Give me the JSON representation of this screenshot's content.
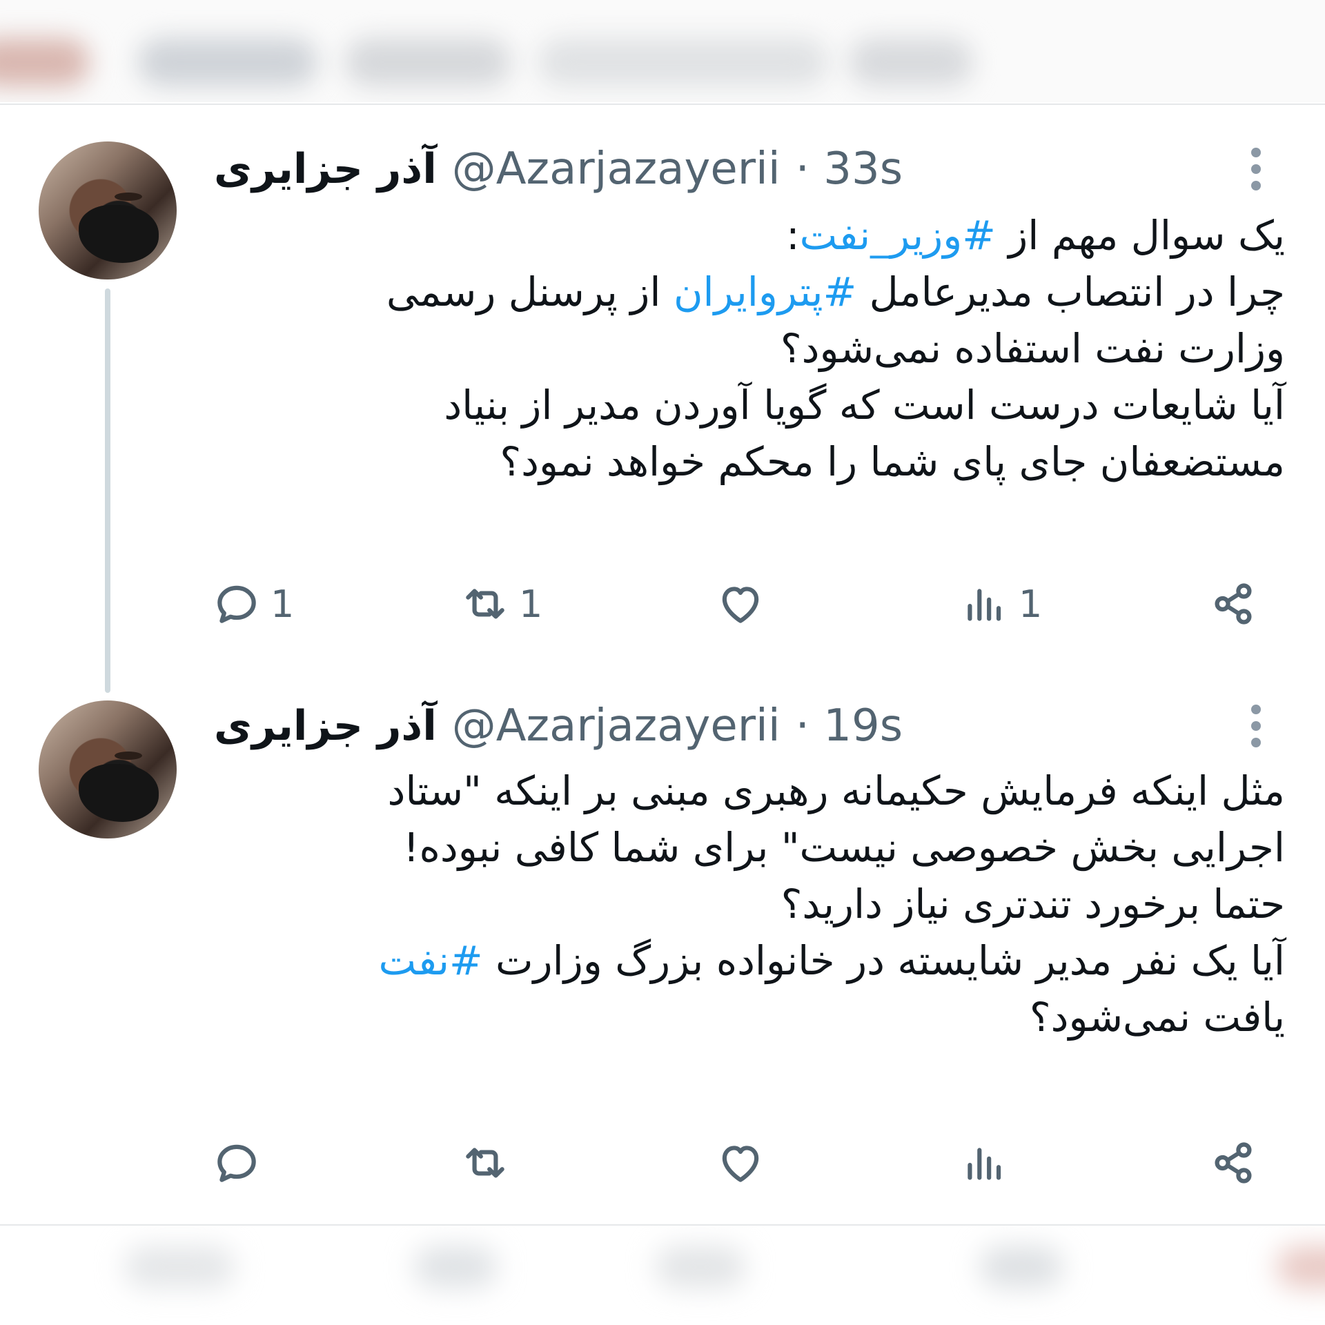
{
  "tweets": [
    {
      "name": "آذر جزایری",
      "handle": "@Azarjazayerii",
      "time": "· 33s",
      "lines": [
        [
          {
            "t": "یک سوال مهم از "
          },
          {
            "t": "#وزیر_نفت",
            "tag": true
          },
          {
            "t": ":"
          }
        ],
        [
          {
            "t": "چرا در انتصاب مدیرعامل "
          },
          {
            "t": "#پتروایران",
            "tag": true
          },
          {
            "t": " از پرسنل رسمی"
          }
        ],
        [
          {
            "t": "وزارت نفت استفاده نمی‌شود؟"
          }
        ],
        [
          {
            "t": "آیا شایعات درست است که گویا آوردن مدیر از بنیاد"
          }
        ],
        [
          {
            "t": "مستضعفان جای پای شما را محکم خواهد نمود؟"
          }
        ]
      ],
      "actions": {
        "reply": "1",
        "retweet": "1",
        "like": "",
        "views": "1"
      }
    },
    {
      "name": "آذر جزایری",
      "handle": "@Azarjazayerii",
      "time": "· 19s",
      "lines": [
        [
          {
            "t": "مثل اینکه فرمایش حکیمانه رهبری مبنی بر اینکه \"ستاد"
          }
        ],
        [
          {
            "t": "اجرایی بخش خصوصی نیست\" برای شما کافی نبوده!"
          }
        ],
        [
          {
            "t": "حتما برخورد تندتری نیاز دارید؟"
          }
        ],
        [
          {
            "t": "آیا یک نفر مدیر شایسته در خانواده بزرگ وزارت "
          },
          {
            "t": "#نفت",
            "tag": true
          }
        ],
        [
          {
            "t": "یافت نمی‌شود؟"
          }
        ]
      ],
      "actions": {
        "reply": "",
        "retweet": "",
        "like": "",
        "views": ""
      }
    }
  ],
  "icons": [
    "reply-icon",
    "retweet-icon",
    "like-icon",
    "views-icon",
    "share-icon",
    "more-icon"
  ],
  "colors": {
    "hashtag": "#1d9bf0",
    "muted": "#536471",
    "thread": "#cfd9de"
  }
}
